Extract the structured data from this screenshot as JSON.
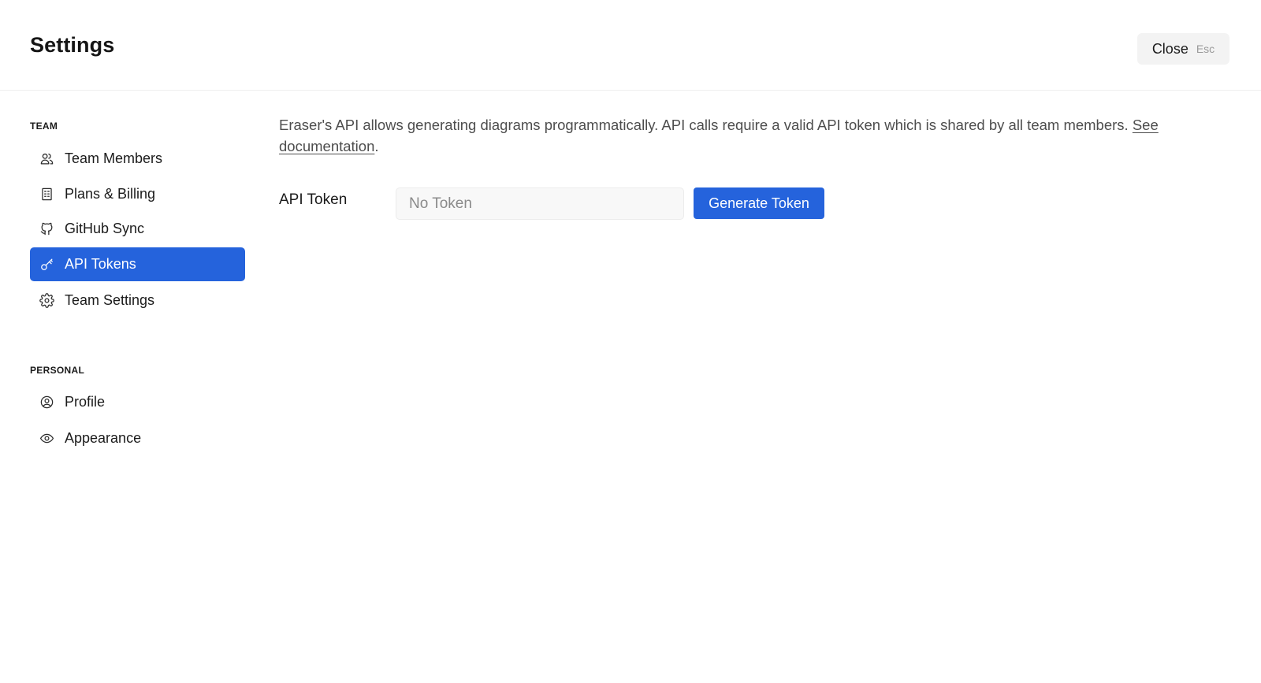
{
  "header": {
    "title": "Settings",
    "close_label": "Close",
    "close_shortcut": "Esc"
  },
  "sidebar": {
    "team_section_label": "TEAM",
    "team_items": [
      {
        "label": "Team Members",
        "icon": "users-icon"
      },
      {
        "label": "Plans & Billing",
        "icon": "receipt-icon"
      },
      {
        "label": "GitHub Sync",
        "icon": "github-icon"
      },
      {
        "label": "API Tokens",
        "icon": "key-icon",
        "active": true
      },
      {
        "label": "Team Settings",
        "icon": "gear-icon"
      }
    ],
    "personal_section_label": "PERSONAL",
    "personal_items": [
      {
        "label": "Profile",
        "icon": "user-circle-icon"
      },
      {
        "label": "Appearance",
        "icon": "eye-icon"
      }
    ]
  },
  "main": {
    "description": "Eraser's API allows generating diagrams programmatically. API calls require a valid API token which is shared by all team members.",
    "docs_link_label": "See documentation",
    "docs_link_suffix": ".",
    "token_label": "API Token",
    "token_value": "",
    "token_placeholder": "No Token",
    "generate_label": "Generate Token"
  },
  "colors": {
    "accent": "#2563dc",
    "text": "#1b1b1b",
    "muted_text": "#4d4d4d",
    "input_bg": "#f8f8f8",
    "close_bg": "#f3f3f3"
  }
}
